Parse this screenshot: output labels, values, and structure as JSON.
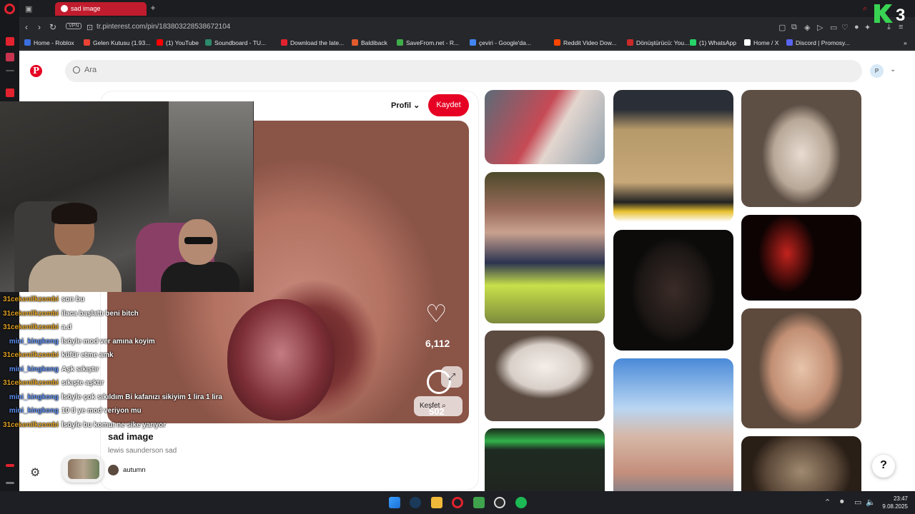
{
  "browser": {
    "tab_title": "sad image",
    "url": "tr.pinterest.com/pin/18380322853867210​4",
    "vpn_label": "VPN",
    "bookmarks": [
      {
        "label": "Home - Roblox",
        "color": "#3b6fe0"
      },
      {
        "label": "Gelen Kutusu (1.93...",
        "color": "#ea4335"
      },
      {
        "label": "(1) YouTube",
        "color": "#ff0000"
      },
      {
        "label": "Soundboard - TU...",
        "color": "#2d8a6a"
      },
      {
        "label": "Download the late...",
        "color": "#e3222f"
      },
      {
        "label": "Baldiback",
        "color": "#e25b2d"
      },
      {
        "label": "SaveFrom.net - R...",
        "color": "#3fae49"
      },
      {
        "label": "çeviri - Google'da...",
        "color": "#4285f4"
      },
      {
        "label": "Reddit Video Dow...",
        "color": "#ff4500"
      },
      {
        "label": "Dönüştürücü: You...",
        "color": "#cc2a2a"
      },
      {
        "label": "(1) WhatsApp",
        "color": "#25d366"
      },
      {
        "label": "Home / X",
        "color": "#ffffff"
      },
      {
        "label": "Discord | Promosy...",
        "color": "#5865f2"
      }
    ]
  },
  "pinterest": {
    "search_placeholder": "Ara",
    "avatar_letter": "P",
    "profile_label": "Profil",
    "save_label": "Kaydet",
    "like_count": "6,112",
    "comment_count": "502",
    "explore_label": "Keşfet",
    "pin_title": "sad image",
    "pin_description": "lewis saunderson sad",
    "author": "autumn",
    "help_label": "?"
  },
  "chat": [
    {
      "user": "31cekenilkzombi",
      "color": "#e0a020",
      "msg": "son bu"
    },
    {
      "user": "31cekenilkzombi",
      "color": "#e0a020",
      "msg": "ilaca başlattı beni bitch"
    },
    {
      "user": "31cekenilkzombi",
      "color": "#e0a020",
      "msg": "a.d"
    },
    {
      "user": "mini_kingkong",
      "color": "#5c8ef2",
      "msg": "İsöyle mod ver amına koyim"
    },
    {
      "user": "31cekenilkzombi",
      "color": "#e0a020",
      "msg": "küfür etme amk"
    },
    {
      "user": "mini_kingkong",
      "color": "#5c8ef2",
      "msg": "Aşk sıkıştır"
    },
    {
      "user": "31cekenilkzombi",
      "color": "#e0a020",
      "msg": "sıkışte aşktır"
    },
    {
      "user": "mini_kingkong",
      "color": "#5c8ef2",
      "msg": "İsöyle çok sıkıldım Bi kafanızı sikiyim 1 lira 1 lira"
    },
    {
      "user": "mini_kingkong",
      "color": "#5c8ef2",
      "msg": "10 tl ye mod veriyon mu"
    },
    {
      "user": "31cekenilkzombi",
      "color": "#e0a020",
      "msg": "İsöyle bu komut ne sike yarıyor"
    }
  ],
  "taskbar": {
    "time": "23:47",
    "date": "9.08.2025"
  },
  "overlay_logo": "3"
}
